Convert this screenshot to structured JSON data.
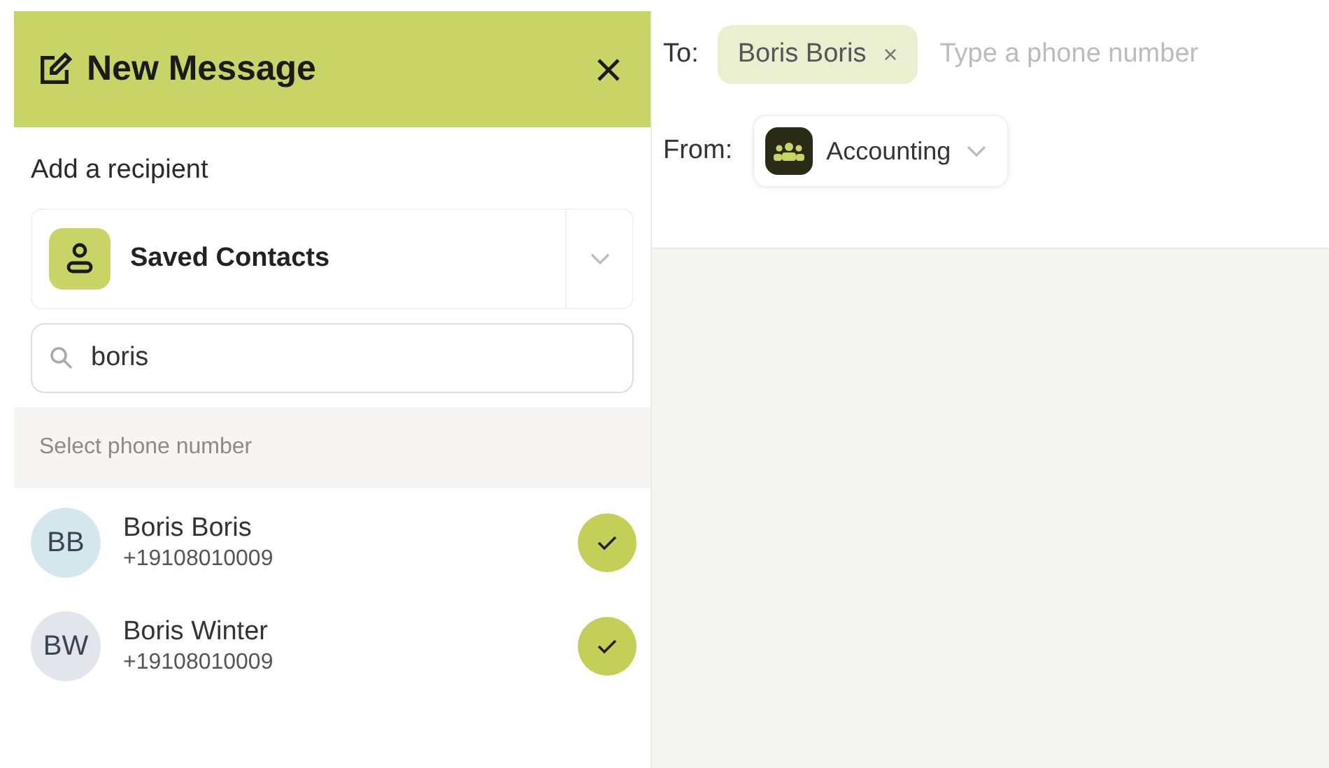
{
  "panel": {
    "title": "New Message",
    "recipient_label": "Add a recipient",
    "source": {
      "label": "Saved Contacts"
    },
    "search": {
      "value": "boris"
    },
    "section_label": "Select phone number"
  },
  "contacts": [
    {
      "initials": "BB",
      "name": "Boris Boris",
      "phone": "+19108010009",
      "color": "#d3e7ec",
      "checked": true
    },
    {
      "initials": "BW",
      "name": "Boris Winter",
      "phone": "+19108010009",
      "color": "#e2e5ec",
      "checked": true
    }
  ],
  "compose": {
    "to_label": "To:",
    "recipients": [
      {
        "name": "Boris Boris",
        "remove": "×"
      }
    ],
    "to_placeholder": "Type a phone number",
    "from_label": "From:",
    "from": {
      "name": "Accounting"
    }
  }
}
